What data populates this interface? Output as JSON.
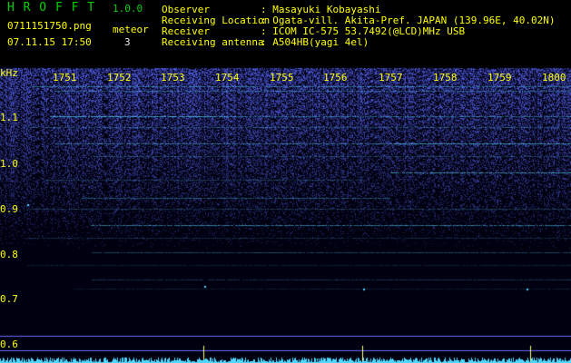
{
  "header": {
    "logo": "H R O F F T",
    "version": "1.0.0",
    "filename": "0711151750.png",
    "datetime": "07.11.15 17:50",
    "meteor_label": "meteor",
    "meteor_count": "3",
    "info": [
      {
        "label": "Observer",
        "value": ": Masayuki Kobayashi"
      },
      {
        "label": "Receiving Location",
        "value": ": Ogata-vill. Akita-Pref. JAPAN (139.96E, 40.02N)"
      },
      {
        "label": "Receiver",
        "value": ": ICOM IC-575 53.7492(@LCD)MHz USB"
      },
      {
        "label": "Receiving antenna",
        "value": ": A504HB(yagi 4el)"
      }
    ]
  },
  "spectrogram": {
    "y_unit": "kHz",
    "time_ticks": [
      "1751",
      "1752",
      "1753",
      "1754",
      "1755",
      "1756",
      "1757",
      "1758",
      "1759",
      "1800"
    ],
    "freq_ticks": [
      "1.1",
      "1.0",
      "0.9",
      "0.8",
      "0.7",
      "0.6"
    ],
    "colors": {
      "background": "#000010",
      "trace": "#4fd8ff",
      "grid": "#6a6aff",
      "marker": "#ffff80"
    }
  }
}
